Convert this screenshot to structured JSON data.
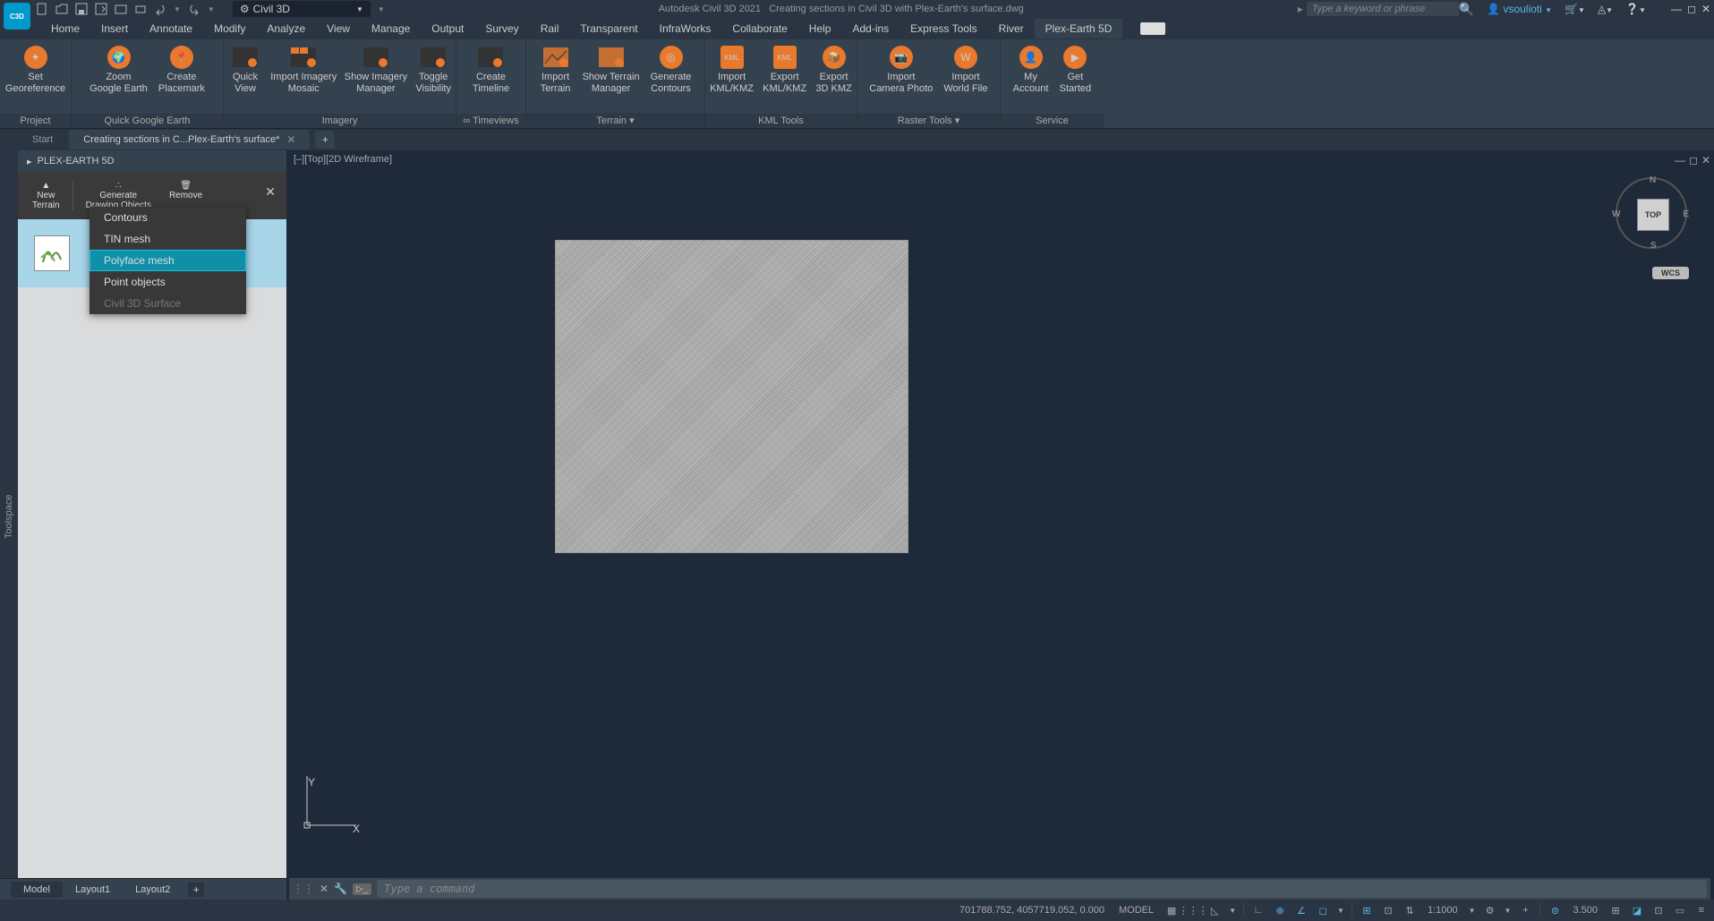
{
  "title": {
    "app": "Autodesk Civil 3D 2021",
    "doc": "Creating sections in Civil 3D with Plex-Earth's surface.dwg"
  },
  "workspace": "Civil 3D",
  "search_placeholder": "Type a keyword or phrase",
  "user": "vsoulioti",
  "menu": [
    "Home",
    "Insert",
    "Annotate",
    "Modify",
    "Analyze",
    "View",
    "Manage",
    "Output",
    "Survey",
    "Rail",
    "Transparent",
    "InfraWorks",
    "Collaborate",
    "Help",
    "Add-ins",
    "Express Tools",
    "River",
    "Plex-Earth 5D"
  ],
  "menu_active": "Plex-Earth 5D",
  "ribbon": {
    "panels": [
      {
        "title": "Project",
        "buttons": [
          {
            "label": "Set\nGeoreference"
          }
        ]
      },
      {
        "title": "Quick Google Earth",
        "buttons": [
          {
            "label": "Zoom\nGoogle Earth"
          },
          {
            "label": "Create\nPlacemark"
          }
        ]
      },
      {
        "title": "Imagery",
        "buttons": [
          {
            "label": "Quick\nView"
          },
          {
            "label": "Import Imagery\nMosaic"
          },
          {
            "label": "Show Imagery\nManager"
          },
          {
            "label": "Toggle\nVisibility"
          }
        ]
      },
      {
        "title": "∞ Timeviews",
        "buttons": [
          {
            "label": "Create\nTimeline"
          }
        ]
      },
      {
        "title": "Terrain ▾",
        "buttons": [
          {
            "label": "Import\nTerrain"
          },
          {
            "label": "Show Terrain\nManager"
          },
          {
            "label": "Generate\nContours"
          }
        ]
      },
      {
        "title": "KML Tools",
        "buttons": [
          {
            "label": "Import\nKML/KMZ"
          },
          {
            "label": "Export\nKML/KMZ"
          },
          {
            "label": "Export\n3D KMZ"
          }
        ]
      },
      {
        "title": "Raster Tools ▾",
        "buttons": [
          {
            "label": "Import\nCamera Photo"
          },
          {
            "label": "Import\nWorld File"
          }
        ]
      },
      {
        "title": "Service",
        "buttons": [
          {
            "label": "My\nAccount"
          },
          {
            "label": "Get\nStarted"
          }
        ]
      }
    ]
  },
  "doctabs": {
    "start": "Start",
    "current": "Creating sections in C...Plex-Earth's surface*"
  },
  "palette": {
    "title": "PLEX-EARTH 5D",
    "tools": [
      {
        "label": "New\nTerrain"
      },
      {
        "label": "Generate\nDrawing Objects"
      },
      {
        "label": "Remove"
      }
    ],
    "dropdown": [
      {
        "label": "Contours",
        "state": ""
      },
      {
        "label": "TIN mesh",
        "state": ""
      },
      {
        "label": "Polyface mesh",
        "state": "hover"
      },
      {
        "label": "Point objects",
        "state": ""
      },
      {
        "label": "Civil 3D Surface",
        "state": "disabled"
      }
    ]
  },
  "viewport": {
    "label": "[–][Top][2D Wireframe]",
    "cube": "TOP",
    "wcs": "WCS"
  },
  "cmd_placeholder": "Type a command",
  "bottomtabs": [
    "Model",
    "Layout1",
    "Layout2"
  ],
  "status": {
    "coords": "701788.752, 4057719.052, 0.000",
    "space": "MODEL",
    "scale": "1:1000",
    "decimal": "3.500"
  },
  "toolspace_label": "Toolspace"
}
